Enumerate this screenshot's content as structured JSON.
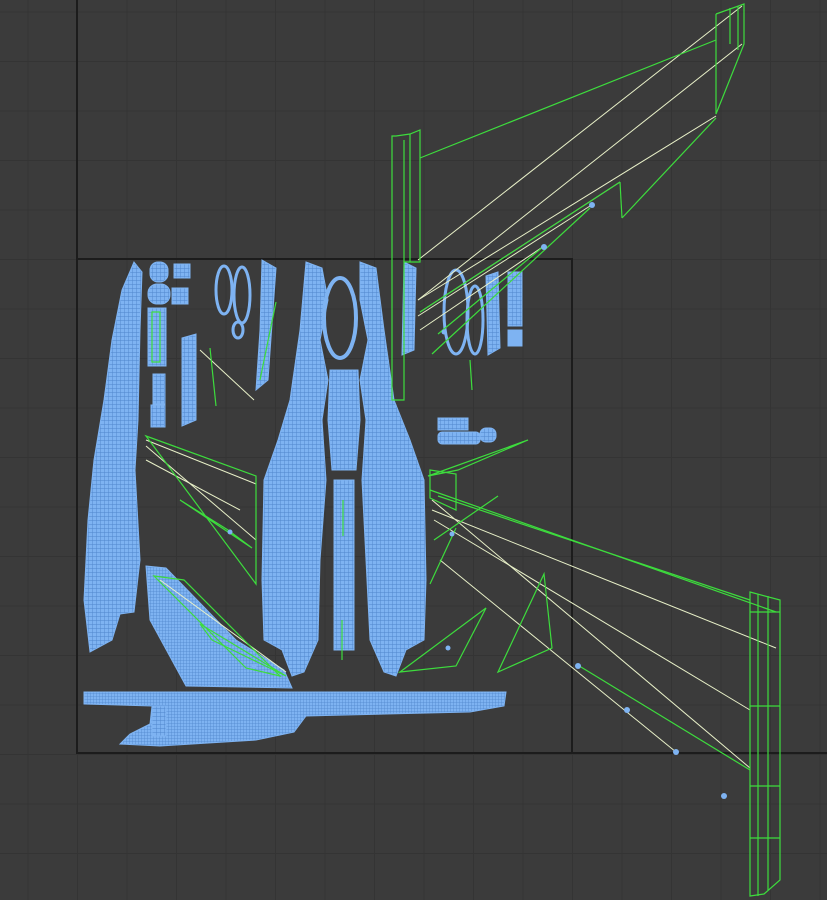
{
  "editor": {
    "view": "UV Editor",
    "background": "#3b3b3b",
    "grid_color": "#343434",
    "tile_border_color": "#1c1c1c"
  },
  "uv_layout": {
    "island_fill": "#7eb3f2",
    "island_wire": "#5e94d6",
    "selected_edge_color": "#3ddc3d",
    "unselected_edge_color": "#e8f0c8",
    "vertex_color": "#7eb3f2"
  }
}
